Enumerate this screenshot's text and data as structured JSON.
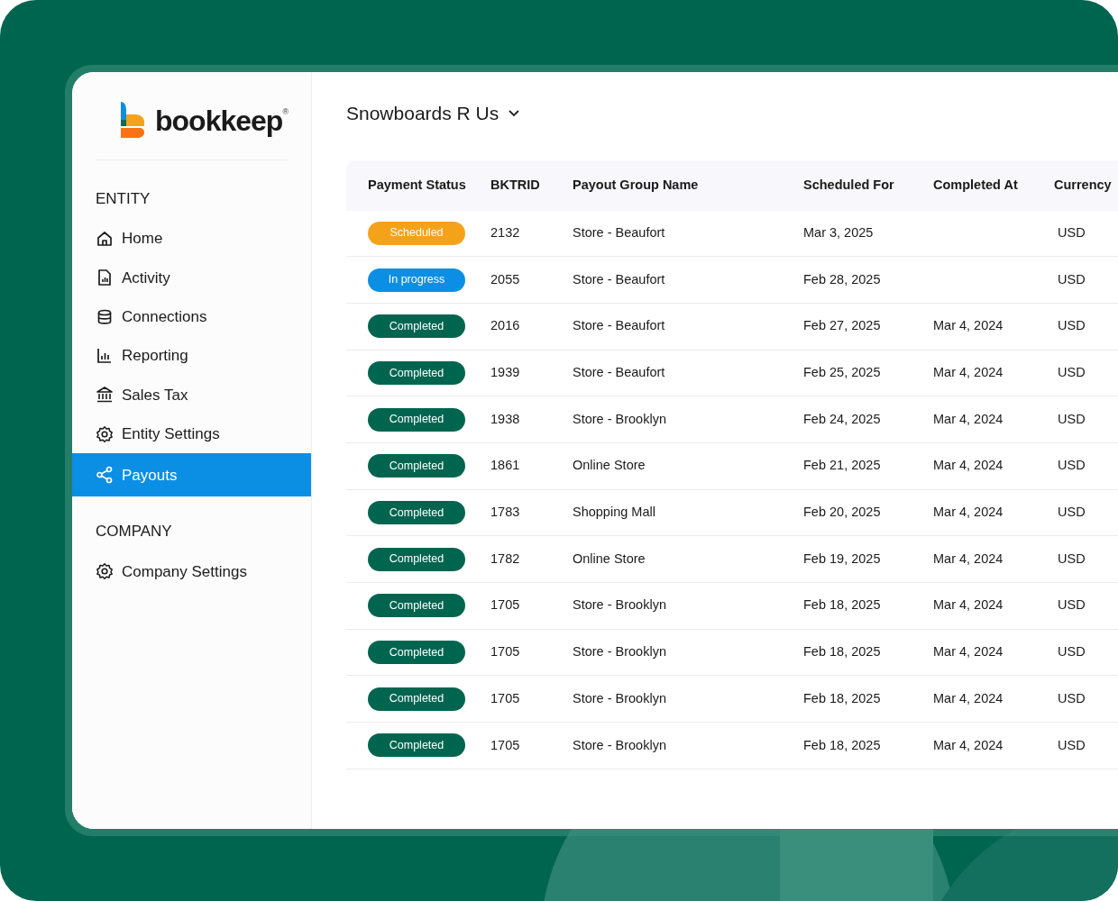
{
  "logo": {
    "wordmark": "bookkeep",
    "mark": "®"
  },
  "sidebar": {
    "sections": [
      {
        "heading": "ENTITY",
        "items": [
          {
            "label": "Home",
            "selected": false
          },
          {
            "label": "Activity",
            "selected": false
          },
          {
            "label": "Connections",
            "selected": false
          },
          {
            "label": "Reporting",
            "selected": false
          },
          {
            "label": "Sales Tax",
            "selected": false
          },
          {
            "label": "Entity Settings",
            "selected": false
          },
          {
            "label": "Payouts",
            "selected": true
          }
        ]
      },
      {
        "heading": "COMPANY",
        "items": [
          {
            "label": "Company Settings",
            "selected": false
          }
        ]
      }
    ]
  },
  "entity_selector": {
    "label": "Snowboards R Us"
  },
  "table": {
    "columns": [
      "Payment Status",
      "BKTRID",
      "Payout Group Name",
      "Scheduled For",
      "Completed At",
      "Currency"
    ],
    "rows": [
      {
        "status": {
          "kind": "scheduled",
          "label": "Scheduled"
        },
        "id": "2132",
        "group": "Store - Beaufort",
        "scheduled": "Mar 3, 2025",
        "currency": "USD"
      },
      {
        "status": {
          "kind": "in_progress",
          "label": "In progress"
        },
        "id": "2055",
        "group": "Store - Beaufort",
        "scheduled": "Feb 28, 2025",
        "currency": "USD"
      },
      {
        "status": {
          "kind": "completed",
          "label": "Completed"
        },
        "id": "2016",
        "group": "Store - Beaufort",
        "scheduled": "Feb 27, 2025",
        "completed": "Mar 4, 2024",
        "currency": "USD"
      },
      {
        "status": {
          "kind": "completed",
          "label": "Completed"
        },
        "id": "1939",
        "group": "Store - Beaufort",
        "scheduled": "Feb 25, 2025",
        "completed": "Mar 4, 2024",
        "currency": "USD"
      },
      {
        "status": {
          "kind": "completed",
          "label": "Completed"
        },
        "id": "1938",
        "group": "Store - Brooklyn",
        "scheduled": "Feb 24, 2025",
        "completed": "Mar 4, 2024",
        "currency": "USD"
      },
      {
        "status": {
          "kind": "completed",
          "label": "Completed"
        },
        "id": "1861",
        "group": "Online Store",
        "scheduled": "Feb 21, 2025",
        "completed": "Mar 4, 2024",
        "currency": "USD"
      },
      {
        "status": {
          "kind": "completed",
          "label": "Completed"
        },
        "id": "1783",
        "group": "Shopping Mall",
        "scheduled": "Feb 20, 2025",
        "completed": "Mar 4, 2024",
        "currency": "USD"
      },
      {
        "status": {
          "kind": "completed",
          "label": "Completed"
        },
        "id": "1782",
        "group": "Online Store",
        "scheduled": "Feb 19, 2025",
        "completed": "Mar 4, 2024",
        "currency": "USD"
      },
      {
        "status": {
          "kind": "completed",
          "label": "Completed"
        },
        "id": "1705",
        "group": "Store - Brooklyn",
        "scheduled": "Feb 18, 2025",
        "completed": "Mar 4, 2024",
        "currency": "USD"
      },
      {
        "status": {
          "kind": "completed",
          "label": "Completed"
        },
        "id": "1705",
        "group": "Store - Brooklyn",
        "scheduled": "Feb 18, 2025",
        "completed": "Mar 4, 2024",
        "currency": "USD"
      },
      {
        "status": {
          "kind": "completed",
          "label": "Completed"
        },
        "id": "1705",
        "group": "Store - Brooklyn",
        "scheduled": "Feb 18, 2025",
        "completed": "Mar 4, 2024",
        "currency": "USD"
      },
      {
        "status": {
          "kind": "completed",
          "label": "Completed"
        },
        "id": "1705",
        "group": "Store - Brooklyn",
        "scheduled": "Feb 18, 2025",
        "completed": "Mar 4, 2024",
        "currency": "USD"
      }
    ]
  }
}
